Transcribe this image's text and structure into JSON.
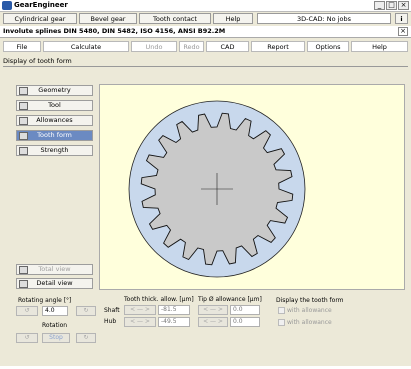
{
  "window": {
    "title": "GearEngineer"
  },
  "top_tabs": [
    "Cylindrical gear",
    "Bevel gear",
    "Tooth contact analysis",
    "Help"
  ],
  "status": "3D-CAD: No jobs",
  "standard_title": "Involute splines DIN 5480, DIN 5482, ISO 4156, ANSI B92.2M",
  "menu": [
    "File",
    "Calculate",
    "Undo",
    "Redo",
    "CAD",
    "Report",
    "Options",
    "Help"
  ],
  "section_label": "Display of tooth form",
  "nav": [
    "Geometry",
    "Tool",
    "Allowances",
    "Tooth form",
    "Strength"
  ],
  "view_buttons": {
    "total": "Total view",
    "detail": "Detail view"
  },
  "rotating": {
    "label": "Rotating angle [°]",
    "value": "4.0",
    "rotation_label": "Rotation",
    "stop": "Stop"
  },
  "tooth_thick": {
    "label": "Tooth thick. allow. [µm]",
    "shaft_label": "Shaft",
    "hub_label": "Hub",
    "shaft_value": "-81.5",
    "hub_value": "-49.5"
  },
  "tip_allowance": {
    "label": "Tip Ø allowance [µm]",
    "shaft_value": "0.0",
    "hub_value": "0.0"
  },
  "display_form": {
    "label": "Display the tooth form",
    "with_allowance_1": "with allowance",
    "with_allowance_2": "with allowance"
  },
  "colors": {
    "drawing_bg": "#ffffdc",
    "hub_fill": "#c8d8ec",
    "shaft_fill": "#c9c9c9",
    "active_nav": "#6b8ac2"
  }
}
